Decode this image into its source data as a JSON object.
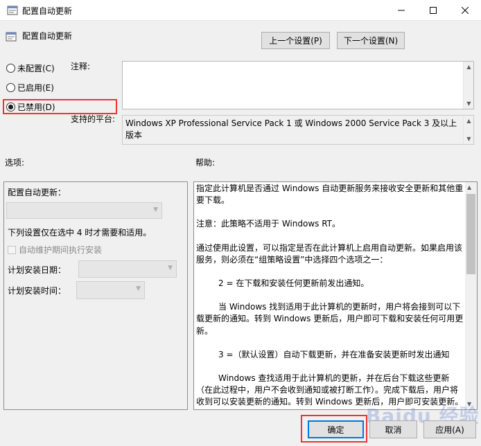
{
  "window": {
    "title": "配置自动更新"
  },
  "header": {
    "title": "配置自动更新",
    "prev_label": "上一个设置(P)",
    "next_label": "下一个设置(N)"
  },
  "radios": [
    {
      "label": "未配置(C)",
      "selected": false
    },
    {
      "label": "已启用(E)",
      "selected": false
    },
    {
      "label": "已禁用(D)",
      "selected": true
    }
  ],
  "comment": {
    "label": "注释:",
    "value": ""
  },
  "platform": {
    "label": "支持的平台:",
    "value": "Windows XP Professional Service Pack 1 或 Windows 2000 Service Pack 3 及以上版本"
  },
  "options": {
    "label": "选项:",
    "title": "配置自动更新：",
    "note": "下列设置仅在选中 4 时才需要和适用。",
    "maint_checkbox": "自动维护期间执行安装",
    "day_label": "计划安装日期：",
    "time_label": "计划安装时间："
  },
  "help": {
    "label": "帮助:",
    "paragraphs": [
      "指定此计算机是否通过 Windows 自动更新服务来接收安全更新和其他重要下载。",
      "注意：此策略不适用于 Windows RT。",
      "通过使用此设置，可以指定是否在此计算机上启用自动更新。如果启用该服务，则必须在“组策略设置”中选择四个选项之一：",
      "2 = 在下载和安装任何更新前发出通知。",
      "当 Windows 找到适用于此计算机的更新时，用户将会接到可以下载更新的通知。转到 Windows 更新后，用户即可下载和安装任何可用更新。",
      "3 =（默认设置）自动下载更新，并在准备安装更新时发出通知",
      "Windows 查找适用于此计算机的更新，并在后台下载这些更新（在此过程中，用户不会收到通知或被打断工作）。完成下载后，用户将收到可以安装更新的通知。转到 Windows 更新后，用户即可安装更新。"
    ]
  },
  "buttons": {
    "ok": "确定",
    "cancel": "取消",
    "apply": "应用(A)"
  },
  "watermark": "Baidu 经验",
  "colors": {
    "highlight": "#ee3333",
    "focus": "#0078d7"
  }
}
